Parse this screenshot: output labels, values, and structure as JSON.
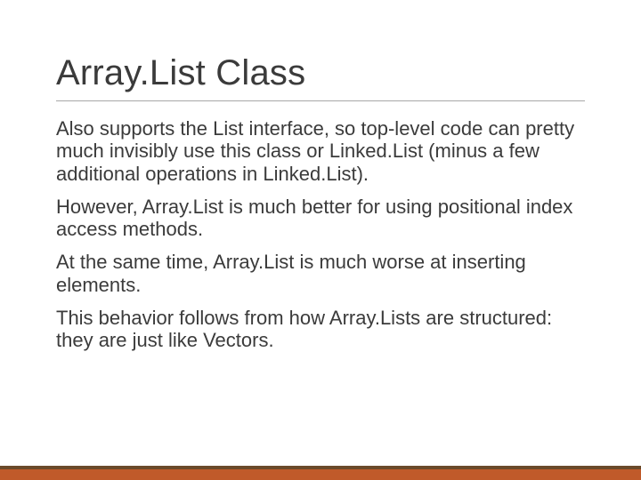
{
  "slide": {
    "title": "Array.List Class",
    "paragraphs": [
      "Also supports the List interface, so top-level code can pretty much invisibly use this class or Linked.List (minus a few additional operations in Linked.List).",
      "However, Array.List is much better for using positional index access methods.",
      "At the same time, Array.List is much worse at inserting elements.",
      "This behavior follows from how Array.Lists are structured: they are just like Vectors."
    ]
  }
}
